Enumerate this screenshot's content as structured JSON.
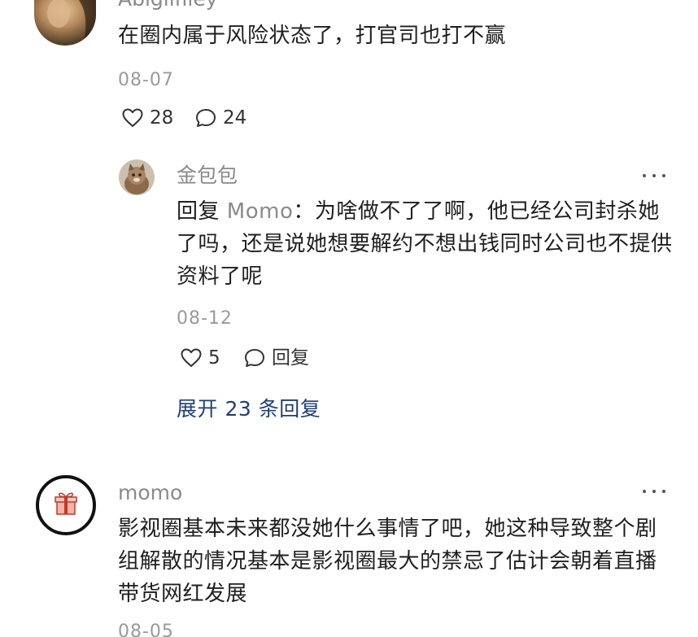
{
  "comments": [
    {
      "username": "Abigilfiley",
      "text": "在圈内属于风险状态了，打官司也打不赢",
      "date": "08-07",
      "likes": "28",
      "replies": "24",
      "avatar_icon": "user-photo-avatar"
    },
    {
      "username": "momo",
      "text": "影视圈基本未来都没她什么事情了吧，她这种导致整个剧组解散的情况基本是影视圈最大的禁忌了估计会朝着直播带货网红发展",
      "date": "08-05",
      "avatar_icon": "gift-icon"
    }
  ],
  "reply": {
    "username": "金包包",
    "prefix": "回复",
    "mention": "Momo",
    "separator": "：",
    "text": "为啥做不了了啊，他已经公司封杀她了吗，还是说她想要解约不想出钱同时公司也不提供资料了呢",
    "date": "08-12",
    "likes": "5",
    "reply_label": "回复",
    "avatar_icon": "cat-photo-avatar"
  },
  "expand_label": "展开 23 条回复",
  "colors": {
    "text": "#1f1f1f",
    "muted": "#8a8a8a",
    "link": "#1e3e78",
    "background": "#ffffff"
  }
}
